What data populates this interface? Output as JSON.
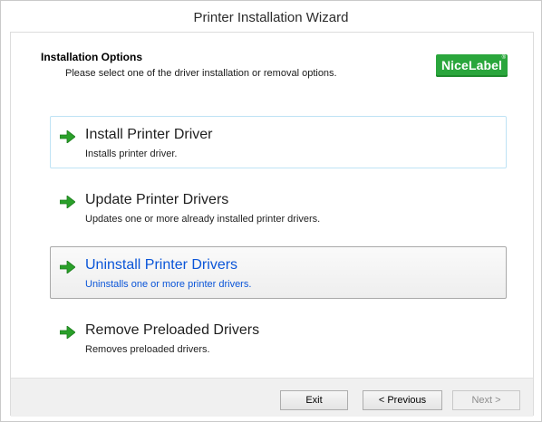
{
  "window": {
    "title": "Printer Installation Wizard"
  },
  "header": {
    "title": "Installation Options",
    "subtitle": "Please select one of the driver installation or removal options.",
    "logo_text": "NiceLabel",
    "logo_mark": "®",
    "logo_color": "#2aa63c"
  },
  "options": [
    {
      "title": "Install Printer Driver",
      "description": "Installs printer driver.",
      "icon": "green-arrow-right-icon",
      "state": "focused"
    },
    {
      "title": "Update Printer Drivers",
      "description": "Updates one or more already installed printer drivers.",
      "icon": "green-arrow-right-icon",
      "state": "normal"
    },
    {
      "title": "Uninstall Printer Drivers",
      "description": "Uninstalls one or more printer drivers.",
      "icon": "green-arrow-right-icon",
      "state": "hovered"
    },
    {
      "title": "Remove Preloaded Drivers",
      "description": "Removes preloaded drivers.",
      "icon": "green-arrow-right-icon",
      "state": "normal"
    }
  ],
  "footer": {
    "exit_label": "Exit",
    "previous_label": "< Previous",
    "next_label": "Next >",
    "next_enabled": false
  },
  "colors": {
    "hover_text": "#0a55d8",
    "arrow": "#2aa02a"
  }
}
